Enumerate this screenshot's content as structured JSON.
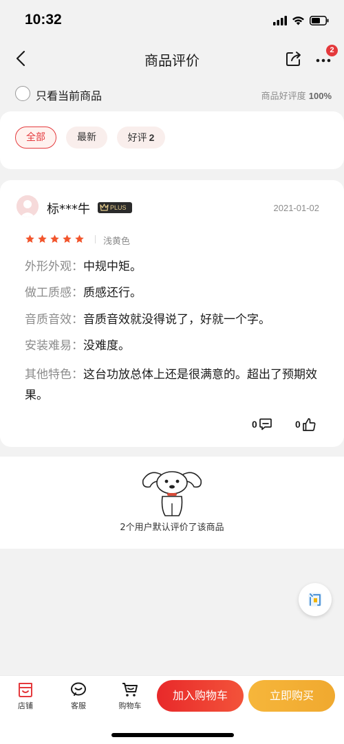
{
  "status_bar": {
    "time": "10:32"
  },
  "nav": {
    "title": "商品评价",
    "badge_count": "2"
  },
  "filter": {
    "only_current_label": "只看当前商品",
    "rate_label": "商品好评度",
    "rate_value": "100%"
  },
  "tags": {
    "all": "全部",
    "newest": "最新",
    "good_label": "好评",
    "good_count": "2"
  },
  "review": {
    "username": "标***牛",
    "member_badge": "PLUS",
    "date": "2021-01-02",
    "stars": 5,
    "variant": "浅黄色",
    "lines": [
      {
        "label": "外形外观：",
        "value": "中规中矩。"
      },
      {
        "label": "做工质感：",
        "value": "质感还行。"
      },
      {
        "label": "音质音效：",
        "value": "音质音效就没得说了，好就一个字。"
      },
      {
        "label": "安装难易：",
        "value": "没难度。"
      },
      {
        "label": "其他特色：",
        "value": "这台功放总体上还是很满意的。超出了预期效果。"
      }
    ],
    "comment_count": "0",
    "like_count": "0"
  },
  "default_reviews": {
    "text": "2个用户默认评价了该商品"
  },
  "bottom_bar": {
    "store": "店铺",
    "service": "客服",
    "cart": "购物车",
    "add_to_cart": "加入购物车",
    "buy_now": "立即购买"
  },
  "colors": {
    "accent_red": "#e4393c",
    "buy_orange": "#f4b03a",
    "star": "#f2552c"
  },
  "icons": [
    "back-arrow-icon",
    "share-icon",
    "more-icon",
    "star-icon",
    "comment-icon",
    "thumbs-up-icon",
    "help-icon",
    "store-icon",
    "service-icon",
    "cart-icon"
  ]
}
